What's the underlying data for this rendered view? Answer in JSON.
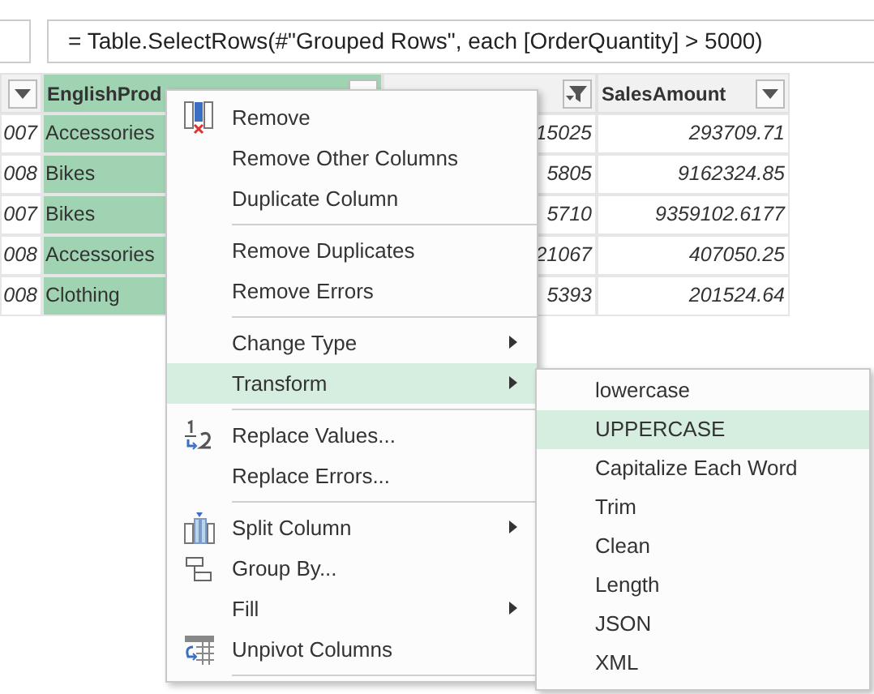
{
  "formula_bar": {
    "formula": "= Table.SelectRows(#\"Grouped Rows\", each [OrderQuantity] > 5000)"
  },
  "table": {
    "columns": [
      {
        "selected": false,
        "filtered": false
      },
      {
        "label": "EnglishProd",
        "selected": true,
        "filtered": false
      },
      {
        "selected": false,
        "filtered": true
      },
      {
        "label": "SalesAmount",
        "selected": false,
        "filtered": false
      }
    ],
    "rows": [
      [
        "007",
        "Accessories",
        "15025",
        "293709.71"
      ],
      [
        "008",
        "Bikes",
        "5805",
        "9162324.85"
      ],
      [
        "007",
        "Bikes",
        "5710",
        "9359102.6177"
      ],
      [
        "008",
        "Accessories",
        "21067",
        "407050.25"
      ],
      [
        "008",
        "Clothing",
        "5393",
        "201524.64"
      ]
    ]
  },
  "context_menu": {
    "groups": [
      [
        {
          "label": "Remove",
          "kind": "remove",
          "submenu": false,
          "selected": false
        },
        {
          "label": "Remove Other Columns",
          "kind": "plain",
          "submenu": false,
          "selected": false
        },
        {
          "label": "Duplicate Column",
          "kind": "plain",
          "submenu": false,
          "selected": false
        }
      ],
      [
        {
          "label": "Remove Duplicates",
          "kind": "plain",
          "submenu": false,
          "selected": false
        },
        {
          "label": "Remove Errors",
          "kind": "plain",
          "submenu": false,
          "selected": false
        }
      ],
      [
        {
          "label": "Change Type",
          "kind": "plain",
          "submenu": true,
          "selected": false
        },
        {
          "label": "Transform",
          "kind": "plain",
          "submenu": true,
          "selected": true
        }
      ],
      [
        {
          "label": "Replace Values...",
          "kind": "replace",
          "submenu": false,
          "selected": false
        },
        {
          "label": "Replace Errors...",
          "kind": "plain",
          "submenu": false,
          "selected": false
        }
      ],
      [
        {
          "label": "Split Column",
          "kind": "split",
          "submenu": true,
          "selected": false
        },
        {
          "label": "Group By...",
          "kind": "group",
          "submenu": false,
          "selected": false
        },
        {
          "label": "Fill",
          "kind": "plain",
          "submenu": true,
          "selected": false
        },
        {
          "label": "Unpivot Columns",
          "kind": "unpivot",
          "submenu": false,
          "selected": false
        }
      ]
    ]
  },
  "submenu": {
    "items": [
      {
        "label": "lowercase",
        "selected": false
      },
      {
        "label": "UPPERCASE",
        "selected": true
      },
      {
        "label": "Capitalize Each Word",
        "selected": false
      },
      {
        "label": "Trim",
        "selected": false
      },
      {
        "label": "Clean",
        "selected": false
      },
      {
        "label": "Length",
        "selected": false
      },
      {
        "label": "JSON",
        "selected": false
      },
      {
        "label": "XML",
        "selected": false
      }
    ]
  }
}
